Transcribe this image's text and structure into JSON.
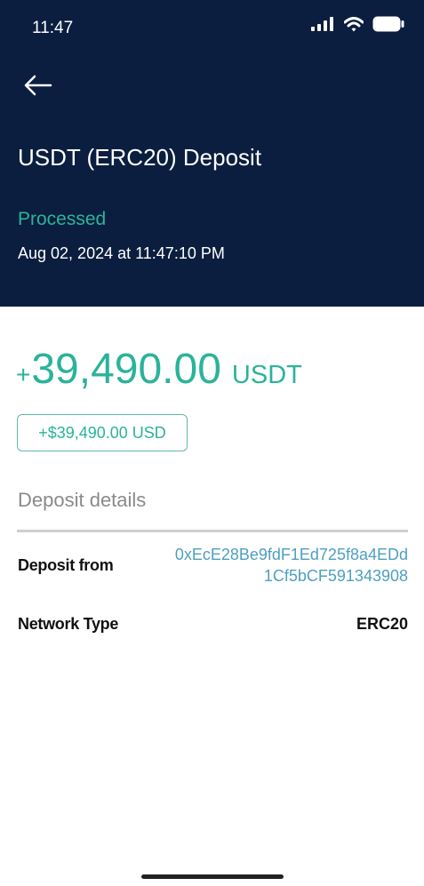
{
  "status_bar": {
    "time": "11:47",
    "icons": [
      "cellular-signal-icon",
      "wifi-icon",
      "battery-icon"
    ]
  },
  "header": {
    "back_icon": "arrow-left-icon",
    "title": "USDT (ERC20) Deposit",
    "status": "Processed",
    "datetime": "Aug 02, 2024 at 11:47:10 PM"
  },
  "amount": {
    "sign": "+",
    "value": "39,490.00",
    "currency": "USDT",
    "usd_equivalent": "+$39,490.00 USD"
  },
  "details": {
    "title": "Deposit details",
    "rows": [
      {
        "label": "Deposit from",
        "value": "0xEcE28Be9fdF1Ed725f8a4EDd1Cf5bCF591343908"
      },
      {
        "label": "Network Type",
        "value": "ERC20"
      }
    ]
  },
  "colors": {
    "header_bg": "#0b1e3f",
    "accent_green": "#2bb39a",
    "link_blue": "#4f9fc0",
    "muted_gray": "#8a8a8a"
  }
}
